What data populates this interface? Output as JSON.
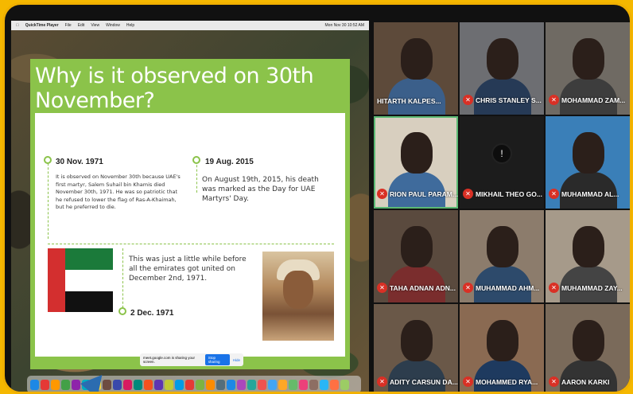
{
  "menubar": {
    "app": "QuickTime Player",
    "items": [
      "File",
      "Edit",
      "View",
      "Window",
      "Help"
    ],
    "clock": "Mon Nov 30 10:52 AM"
  },
  "slide": {
    "title": "Why is it observed on 30th November?",
    "left_date": "30 Nov. 1971",
    "left_text": "It is observed on November 30th because UAE's first martyr, Salem Suhail bin Khamis died November 30th, 1971. He was so patriotic that he refused to lower the flag of Ras-A-Khaimah, but he preferred to die.",
    "right_date": "19 Aug. 2015",
    "right_text": "On August 19th, 2015, his death was marked as the Day for UAE Martyrs' Day.",
    "bottom_text": "This was just a little while before all the emirates got united on December 2nd, 1971.",
    "bottom_date": "2 Dec. 1971"
  },
  "share_bar": {
    "message": "meet.google.com is sharing your screen.",
    "stop": "Stop sharing",
    "hide": "Hide"
  },
  "participants": [
    {
      "name": "HITARTH KALPES...",
      "muted": false,
      "bg": "#5d4a3a",
      "shirt": "#3b5f8a",
      "active": false
    },
    {
      "name": "CHRIS STANLEY S...",
      "muted": true,
      "bg": "#6d6e72",
      "shirt": "#263a56",
      "active": false
    },
    {
      "name": "MOHAMMAD ZAM...",
      "muted": true,
      "bg": "#6f6a63",
      "shirt": "#3d3d3d",
      "active": false
    },
    {
      "name": "RION PAUL PARAM...",
      "muted": true,
      "bg": "#d8cfbf",
      "shirt": "#3f6b9c",
      "active": true
    },
    {
      "name": "MIKHAIL THEO GO...",
      "muted": true,
      "bg": "#1c1c1c",
      "shirt": "#1c1c1c",
      "active": false
    },
    {
      "name": "MUHAMMAD AL...",
      "muted": true,
      "bg": "#3a7fb8",
      "shirt": "#2a2a2a",
      "active": false
    },
    {
      "name": "TAHA ADNAN ADN...",
      "muted": true,
      "bg": "#5a4a3e",
      "shirt": "#7a2d2d",
      "active": false
    },
    {
      "name": "MUHAMMAD AHM...",
      "muted": true,
      "bg": "#8c7c6c",
      "shirt": "#2d4a6b",
      "active": false
    },
    {
      "name": "MUHAMMAD ZAY...",
      "muted": true,
      "bg": "#a69a8a",
      "shirt": "#444",
      "active": false
    },
    {
      "name": "ADITY CARSUN DA...",
      "muted": true,
      "bg": "#6a5848",
      "shirt": "#2d3d4d",
      "active": false
    },
    {
      "name": "MOHAMMED RYA...",
      "muted": true,
      "bg": "#8a6a52",
      "shirt": "#1e3a5f",
      "active": false
    },
    {
      "name": "AARON KARKI",
      "muted": true,
      "bg": "#7a6a5a",
      "shirt": "#333",
      "active": false
    }
  ],
  "dock_colors": [
    "#1e88e5",
    "#e53935",
    "#ff9800",
    "#43a047",
    "#8e24aa",
    "#00acc1",
    "#fdd835",
    "#6d4c41",
    "#3949ab",
    "#d81b60",
    "#00897b",
    "#f4511e",
    "#5e35b1",
    "#c0ca33",
    "#039be5",
    "#e53935",
    "#7cb342",
    "#fb8c00",
    "#546e7a",
    "#1e88e5",
    "#ab47bc",
    "#26a69a",
    "#ef5350",
    "#42a5f5",
    "#ffa726",
    "#66bb6a",
    "#ec407a",
    "#8d6e63",
    "#29b6f6",
    "#ff7043",
    "#9ccc65"
  ]
}
